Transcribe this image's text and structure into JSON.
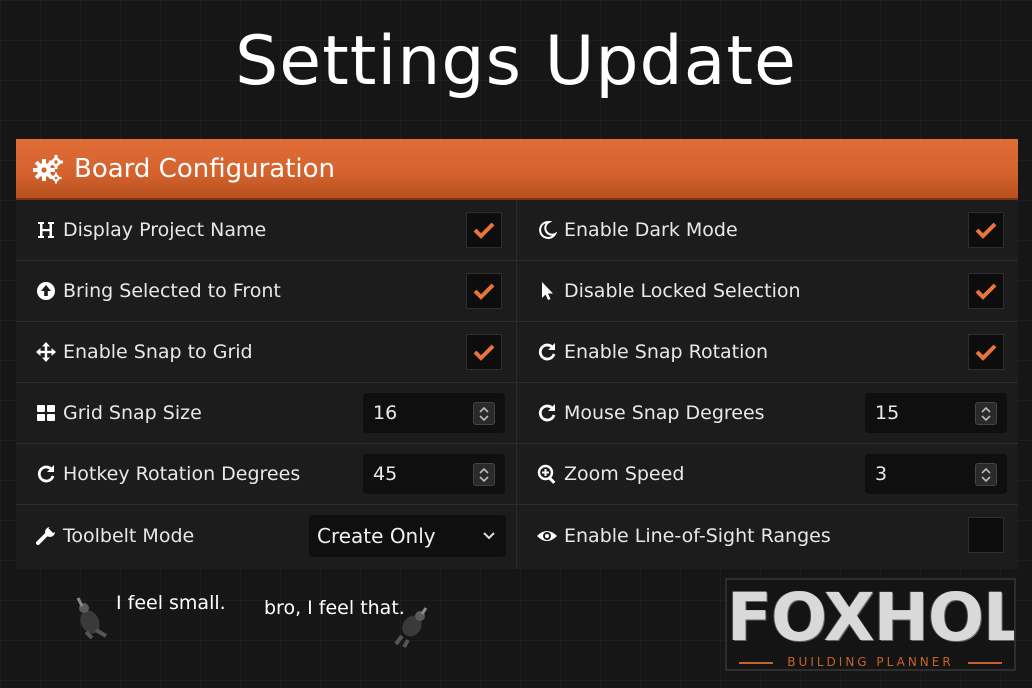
{
  "title": "Settings Update",
  "colors": {
    "accent": "#d9652f",
    "check": "#e8763a",
    "background": "#161616"
  },
  "panel": {
    "header": {
      "icon": "gears-icon",
      "label": "Board Configuration"
    },
    "rows": [
      {
        "left": {
          "icon": "heading-icon",
          "label": "Display Project Name",
          "control": "checkbox",
          "checked": true
        },
        "right": {
          "icon": "moon-icon",
          "label": "Enable Dark Mode",
          "control": "checkbox",
          "checked": true
        }
      },
      {
        "left": {
          "icon": "arrow-circle-up-icon",
          "label": "Bring Selected to Front",
          "control": "checkbox",
          "checked": true
        },
        "right": {
          "icon": "cursor-icon",
          "label": "Disable Locked Selection",
          "control": "checkbox",
          "checked": true
        }
      },
      {
        "left": {
          "icon": "move-arrows-icon",
          "label": "Enable Snap to Grid",
          "control": "checkbox",
          "checked": true
        },
        "right": {
          "icon": "rotate-icon",
          "label": "Enable Snap Rotation",
          "control": "checkbox",
          "checked": true
        }
      },
      {
        "left": {
          "icon": "grid-icon",
          "label": "Grid Snap Size",
          "control": "number",
          "value": "16"
        },
        "right": {
          "icon": "rotate-icon",
          "label": "Mouse Snap Degrees",
          "control": "number",
          "value": "15"
        }
      },
      {
        "left": {
          "icon": "rotate-icon",
          "label": "Hotkey Rotation Degrees",
          "control": "number",
          "value": "45"
        },
        "right": {
          "icon": "zoom-in-icon",
          "label": "Zoom Speed",
          "control": "number",
          "value": "3"
        }
      },
      {
        "left": {
          "icon": "wrench-icon",
          "label": "Toolbelt Mode",
          "control": "select",
          "value": "Create Only"
        },
        "right": {
          "icon": "eye-icon",
          "label": "Enable Line-of-Sight Ranges",
          "control": "checkbox",
          "checked": false
        }
      }
    ]
  },
  "captions": {
    "left": "I feel small.",
    "right": "bro, I feel that."
  },
  "logo": {
    "word": "FOXHOLE",
    "subtitle": "BUILDING PLANNER"
  }
}
